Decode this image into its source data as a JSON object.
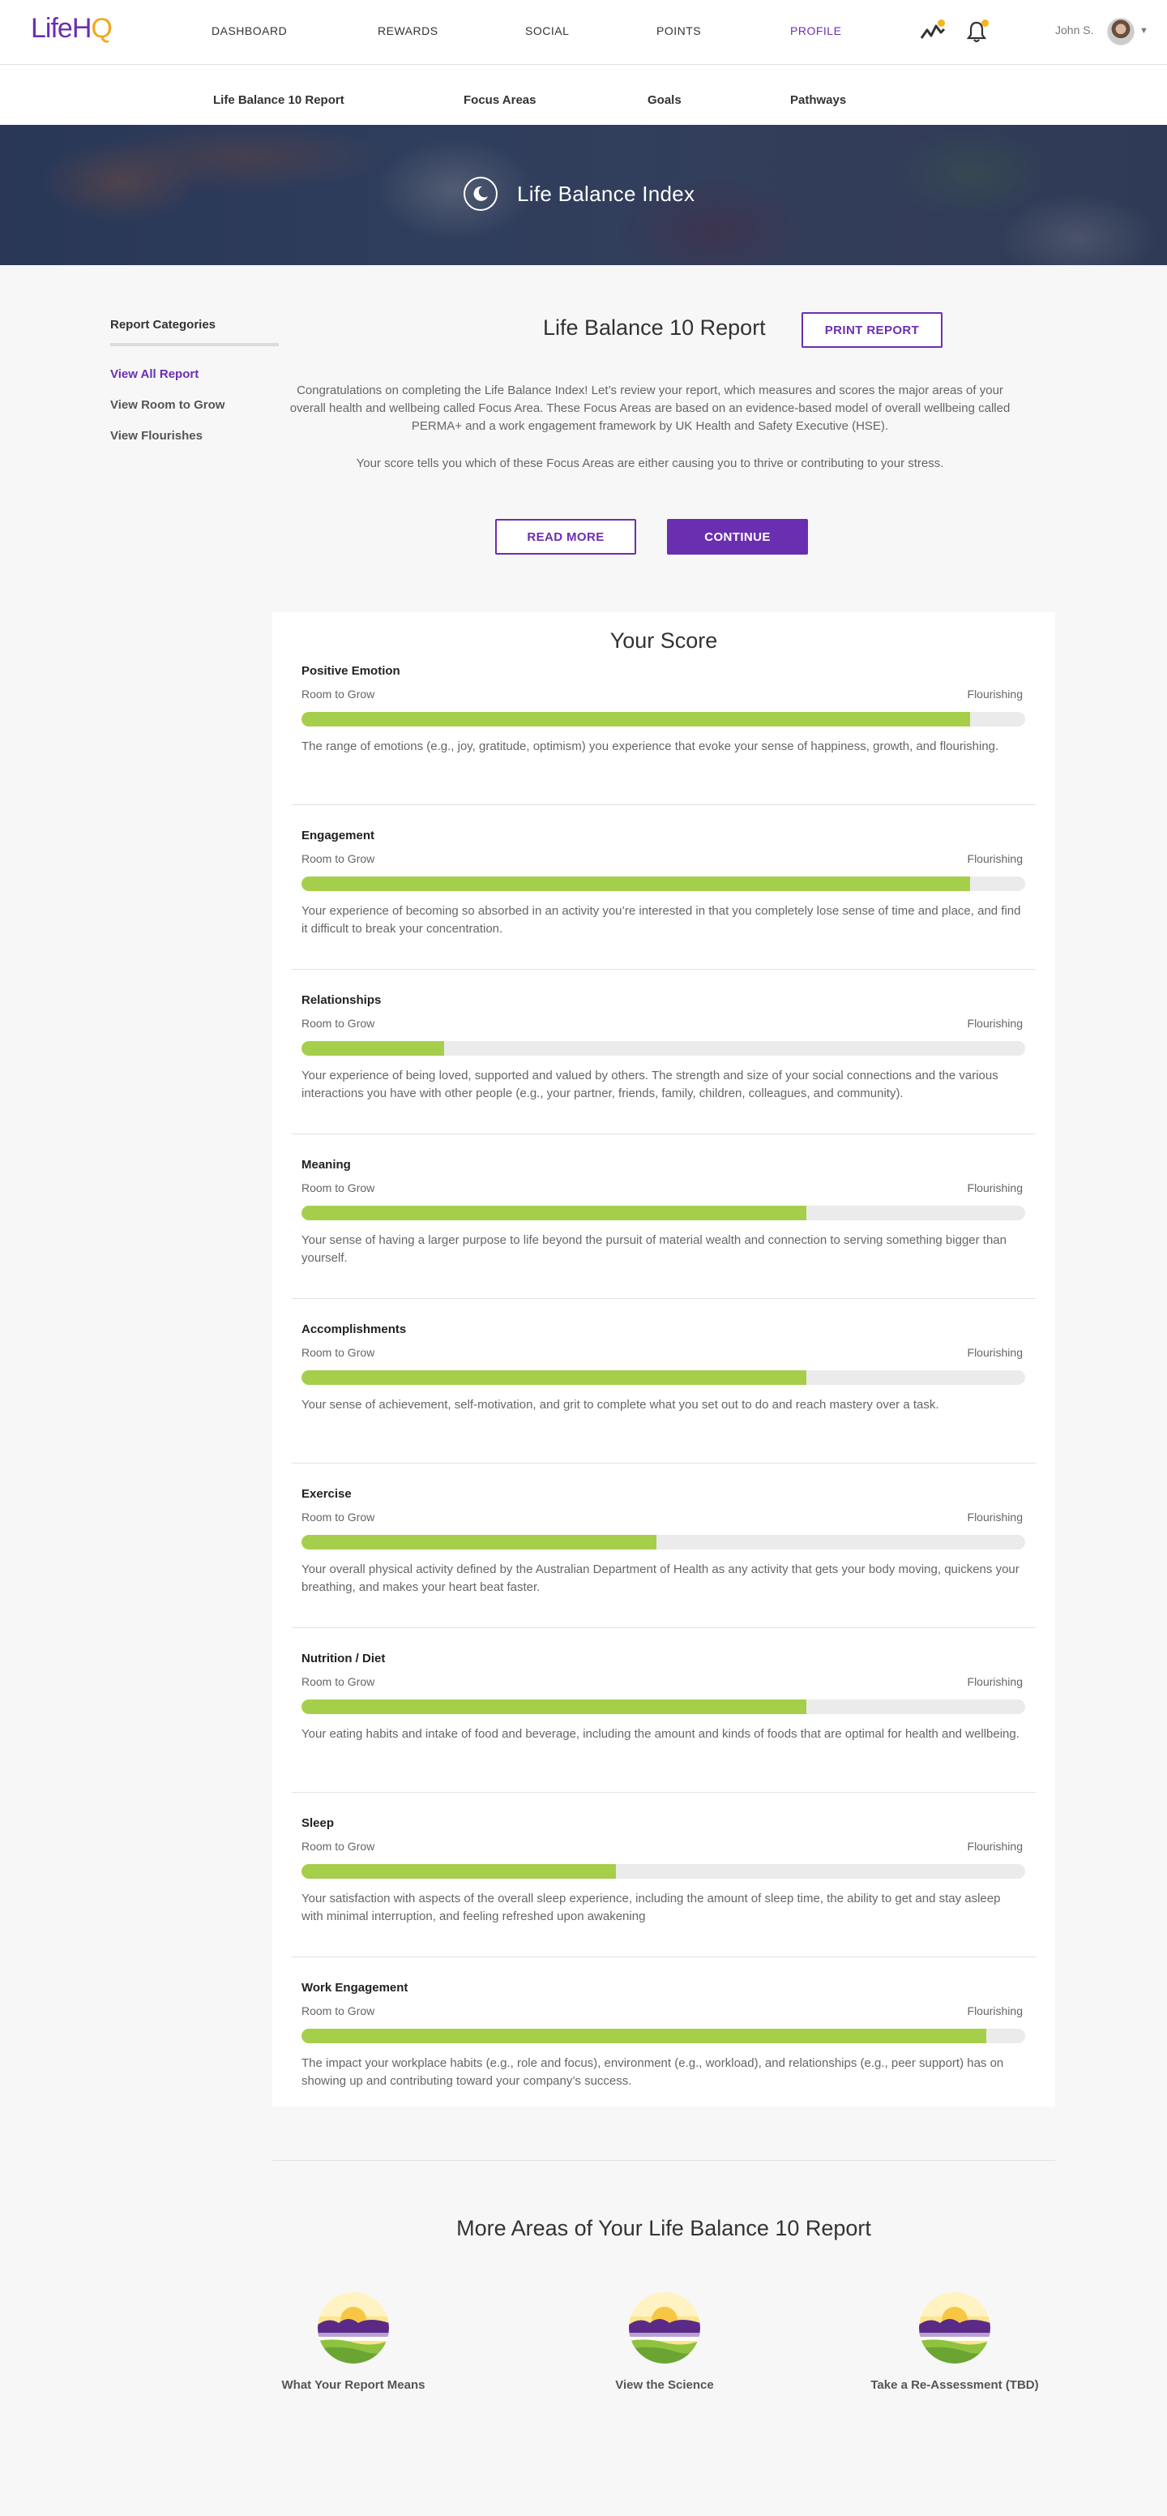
{
  "header": {
    "logo_text": "Life HQ",
    "nav": [
      "DASHBOARD",
      "REWARDS",
      "SOCIAL",
      "POINTS",
      "PROFILE"
    ],
    "active_nav": "PROFILE",
    "user_name": "John S.",
    "accent": "#6a2fb1",
    "badge_color": "#f2b51b"
  },
  "subnav": [
    "Life Balance 10 Report",
    "Focus Areas",
    "Goals",
    "Pathways"
  ],
  "hero": {
    "title": "Life Balance Index",
    "icon": "moon-icon"
  },
  "sidebar": {
    "heading": "Report Categories",
    "links": [
      "View All Report",
      "View Room to Grow",
      "View Flourishes"
    ],
    "active": "View All Report"
  },
  "report": {
    "title": "Life Balance 10 Report",
    "print_label": "PRINT REPORT",
    "intro": "Congratulations on completing the Life Balance Index! Let’s review your report, which measures and scores the major areas of your overall health and wellbeing called Focus Area. These Focus Areas are based on an evidence-based model of overall wellbeing called PERMA+ and a work engagement framework by UK Health and Safety Executive (HSE).",
    "intro2": "Your score tells you which of these Focus Areas are either causing you to thrive or contributing to your stress.",
    "read_more_label": "READ MORE",
    "continue_label": "CONTINUE"
  },
  "score": {
    "title": "Your Score",
    "low_label": "Room to Grow",
    "high_label": "Flourishing",
    "bar_color": "#a5cf4a",
    "sections": [
      {
        "name": "Positive Emotion",
        "value": 0.924,
        "desc": "The range of emotions (e.g., joy, gratitude, optimism) you experience that evoke your sense of happiness, growth, and flourishing."
      },
      {
        "name": "Engagement",
        "value": 0.924,
        "desc": "Your experience of becoming so absorbed in an activity you’re interested in that you completely lose sense of time and place, and find it difficult to break your concentration."
      },
      {
        "name": "Relationships",
        "value": 0.197,
        "desc": "Your experience of being loved, supported and valued by others. The strength and size of your social connections and the various interactions you have with other people (e.g., your partner, friends, family, children, colleagues, and community)."
      },
      {
        "name": "Meaning",
        "value": 0.698,
        "desc": "Your sense of having a larger purpose to life beyond the pursuit of material wealth and connection to serving something bigger than yourself."
      },
      {
        "name": "Accomplishments",
        "value": 0.698,
        "desc": "Your sense of achievement, self-motivation, and grit to complete what you set out to do and reach mastery over a task."
      },
      {
        "name": "Exercise",
        "value": 0.49,
        "desc": "Your overall physical activity defined by the Australian Department of Health as any activity that gets your body moving, quickens your breathing, and makes your heart beat faster."
      },
      {
        "name": "Nutrition / Diet",
        "value": 0.698,
        "desc": "Your eating habits and intake of food and beverage, including the amount and kinds of foods that are optimal for health and wellbeing."
      },
      {
        "name": "Sleep",
        "value": 0.434,
        "desc": "Your satisfaction with aspects of the overall sleep experience, including the amount of sleep time, the ability to get and stay asleep with minimal interruption, and feeling refreshed upon awakening"
      },
      {
        "name": "Work Engagement",
        "value": 0.946,
        "desc": "The impact your workplace habits (e.g., role and focus), environment (e.g., workload), and relationships (e.g., peer support) has on showing up and contributing toward your company’s success."
      }
    ]
  },
  "more": {
    "title": "More Areas of Your Life Balance 10 Report",
    "items": [
      "What Your Report Means",
      "View the Science",
      "Take a Re-Assessment (TBD)"
    ]
  }
}
